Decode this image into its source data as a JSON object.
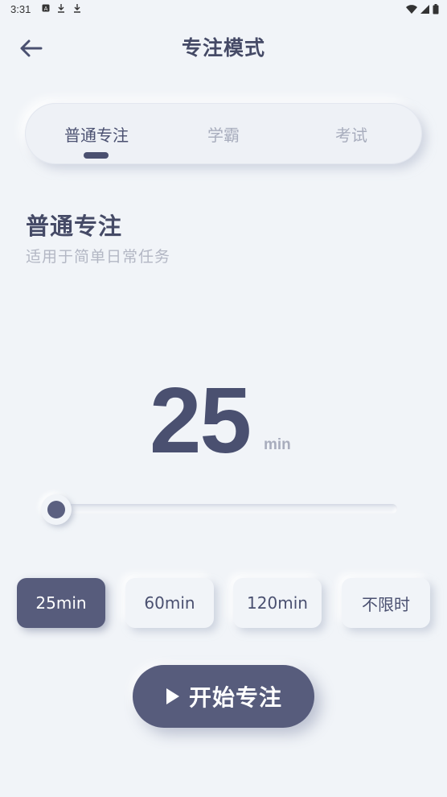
{
  "status_bar": {
    "time": "3:31"
  },
  "header": {
    "title": "专注模式"
  },
  "tabs": [
    {
      "label": "普通专注",
      "active": true
    },
    {
      "label": "学霸",
      "active": false
    },
    {
      "label": "考试",
      "active": false
    }
  ],
  "mode": {
    "title": "普通专注",
    "description": "适用于简单日常任务"
  },
  "timer": {
    "value": "25",
    "unit": "min",
    "slider_fraction": 0.0
  },
  "presets": [
    {
      "label": "25min",
      "active": true
    },
    {
      "label": "60min",
      "active": false
    },
    {
      "label": "120min",
      "active": false
    },
    {
      "label": "不限时",
      "active": false
    }
  ],
  "start_button": {
    "label": "开始专注",
    "icon": "play-icon"
  },
  "colors": {
    "background": "#f1f4f8",
    "accent": "#575c7c",
    "text": "#4a5070",
    "muted": "#a8adbd"
  }
}
